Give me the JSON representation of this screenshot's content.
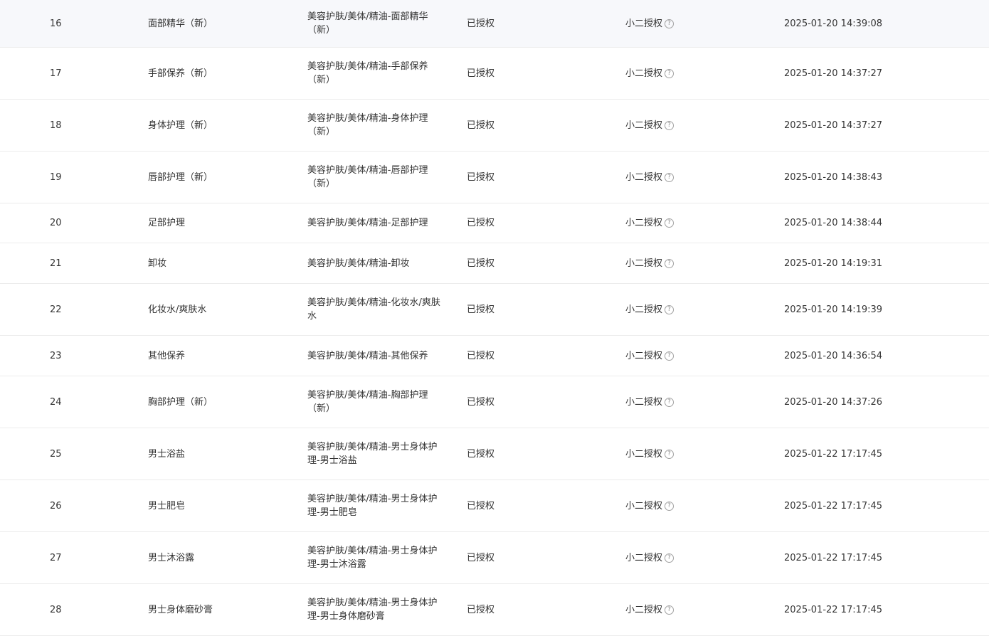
{
  "help_glyph": "?",
  "rows": [
    {
      "index": "16",
      "name": "面部精华（新）",
      "path": "美容护肤/美体/精油-面部精华（新）",
      "status": "已授权",
      "auth_type": "小二授权",
      "time": "2025-01-20 14:39:08"
    },
    {
      "index": "17",
      "name": "手部保养（新）",
      "path": "美容护肤/美体/精油-手部保养（新）",
      "status": "已授权",
      "auth_type": "小二授权",
      "time": "2025-01-20 14:37:27"
    },
    {
      "index": "18",
      "name": "身体护理（新）",
      "path": "美容护肤/美体/精油-身体护理（新）",
      "status": "已授权",
      "auth_type": "小二授权",
      "time": "2025-01-20 14:37:27"
    },
    {
      "index": "19",
      "name": "唇部护理（新）",
      "path": "美容护肤/美体/精油-唇部护理（新）",
      "status": "已授权",
      "auth_type": "小二授权",
      "time": "2025-01-20 14:38:43"
    },
    {
      "index": "20",
      "name": "足部护理",
      "path": "美容护肤/美体/精油-足部护理",
      "status": "已授权",
      "auth_type": "小二授权",
      "time": "2025-01-20 14:38:44"
    },
    {
      "index": "21",
      "name": "卸妆",
      "path": "美容护肤/美体/精油-卸妆",
      "status": "已授权",
      "auth_type": "小二授权",
      "time": "2025-01-20 14:19:31"
    },
    {
      "index": "22",
      "name": "化妆水/爽肤水",
      "path": "美容护肤/美体/精油-化妆水/爽肤水",
      "status": "已授权",
      "auth_type": "小二授权",
      "time": "2025-01-20 14:19:39"
    },
    {
      "index": "23",
      "name": "其他保养",
      "path": "美容护肤/美体/精油-其他保养",
      "status": "已授权",
      "auth_type": "小二授权",
      "time": "2025-01-20 14:36:54"
    },
    {
      "index": "24",
      "name": "胸部护理（新）",
      "path": "美容护肤/美体/精油-胸部护理（新）",
      "status": "已授权",
      "auth_type": "小二授权",
      "time": "2025-01-20 14:37:26"
    },
    {
      "index": "25",
      "name": "男士浴盐",
      "path": "美容护肤/美体/精油-男士身体护理-男士浴盐",
      "status": "已授权",
      "auth_type": "小二授权",
      "time": "2025-01-22 17:17:45"
    },
    {
      "index": "26",
      "name": "男士肥皂",
      "path": "美容护肤/美体/精油-男士身体护理-男士肥皂",
      "status": "已授权",
      "auth_type": "小二授权",
      "time": "2025-01-22 17:17:45"
    },
    {
      "index": "27",
      "name": "男士沐浴露",
      "path": "美容护肤/美体/精油-男士身体护理-男士沐浴露",
      "status": "已授权",
      "auth_type": "小二授权",
      "time": "2025-01-22 17:17:45"
    },
    {
      "index": "28",
      "name": "男士身体磨砂膏",
      "path": "美容护肤/美体/精油-男士身体护理-男士身体磨砂膏",
      "status": "已授权",
      "auth_type": "小二授权",
      "time": "2025-01-22 17:17:45"
    }
  ]
}
